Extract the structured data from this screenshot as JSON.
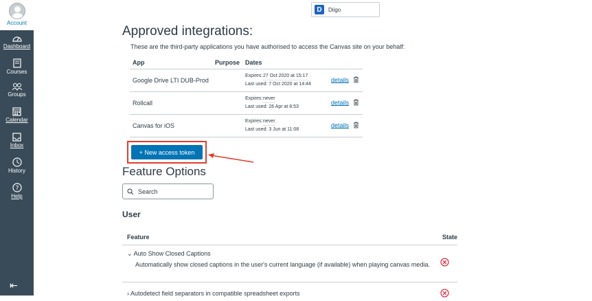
{
  "sidebar": {
    "account_label": "Account",
    "items": [
      {
        "label": "Dashboard",
        "icon": "dashboard-icon"
      },
      {
        "label": "Courses",
        "icon": "courses-icon"
      },
      {
        "label": "Groups",
        "icon": "groups-icon"
      },
      {
        "label": "Calendar",
        "icon": "calendar-icon"
      },
      {
        "label": "Inbox",
        "icon": "inbox-icon"
      },
      {
        "label": "History",
        "icon": "history-icon"
      },
      {
        "label": "Help",
        "icon": "help-icon"
      }
    ],
    "collapse_icon": "collapse-icon",
    "colors": {
      "bg": "#394b58",
      "link": "#0374b5"
    }
  },
  "diigo": {
    "label": "Diigo",
    "logo_letter": "D"
  },
  "integrations": {
    "title": "Approved integrations:",
    "description": "These are the third-party applications you have authorised to access the Canvas site on your behalf:",
    "columns": [
      "App",
      "Purpose",
      "Dates"
    ],
    "rows": [
      {
        "app": "Google Drive LTI DUB-Prod",
        "expires_label": "Expires:",
        "expires": "27 Oct 2020 at 15:17",
        "last_used_label": "Last used:",
        "last_used": "7 Oct 2020 at 14:44",
        "details": "details"
      },
      {
        "app": "Rollcall",
        "expires_label": "Expires:",
        "expires": "never",
        "last_used_label": "Last used:",
        "last_used": "26 Apr at 8:53",
        "details": "details"
      },
      {
        "app": "Canvas for iOS",
        "expires_label": "Expires:",
        "expires": "never",
        "last_used_label": "Last used:",
        "last_used": "3 Jun at 11:08",
        "details": "details"
      }
    ],
    "new_token_button": "+ New access token"
  },
  "features": {
    "title": "Feature Options",
    "search_placeholder": "Search",
    "section": "User",
    "columns": [
      "Feature",
      "State"
    ],
    "rows": [
      {
        "name": "Auto Show Closed Captions",
        "description": "Automatically show closed captions in the user's current language (if available) when playing canvas media.",
        "state": "off"
      },
      {
        "name": "Autodetect field separators in compatible spreadsheet exports",
        "state": "off"
      }
    ]
  },
  "colors": {
    "accent": "#0374b5",
    "highlight": "#e43b2c",
    "off_state": "#e0061f"
  }
}
